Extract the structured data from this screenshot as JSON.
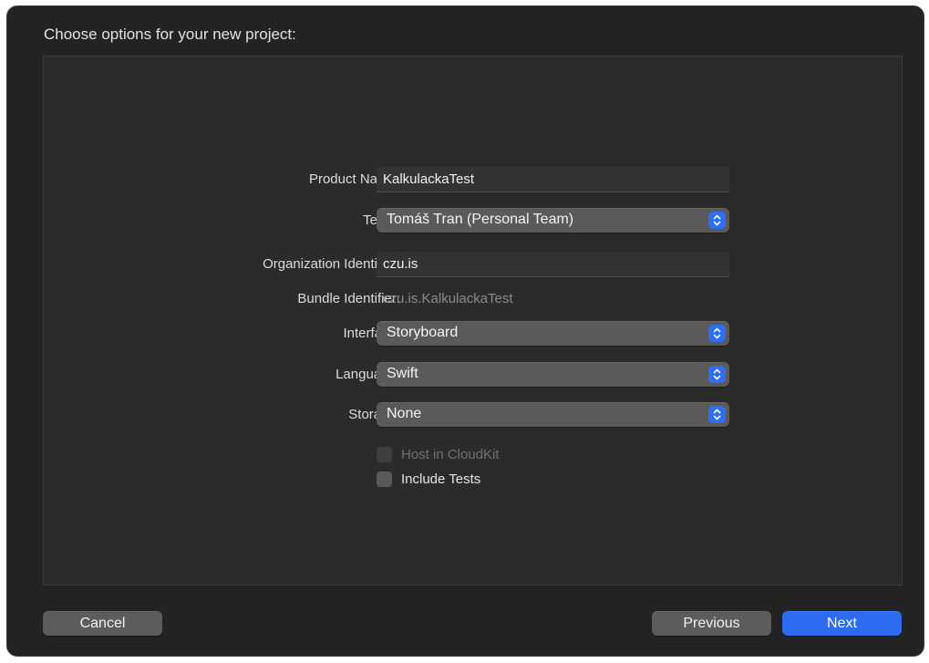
{
  "dialog": {
    "title": "Choose options for your new project:"
  },
  "form": {
    "product_name": {
      "label": "Product Name:",
      "value": "KalkulackaTest"
    },
    "team": {
      "label": "Team:",
      "value": "Tomáš Tran (Personal Team)"
    },
    "organization_identifier": {
      "label": "Organization Identifier:",
      "value": "czu.is"
    },
    "bundle_identifier": {
      "label": "Bundle Identifier:",
      "value": "czu.is.KalkulackaTest"
    },
    "interface": {
      "label": "Interface:",
      "value": "Storyboard"
    },
    "language": {
      "label": "Language:",
      "value": "Swift"
    },
    "storage": {
      "label": "Storage:",
      "value": "None"
    },
    "host_in_cloudkit": {
      "label": "Host in CloudKit",
      "checked": false,
      "enabled": false
    },
    "include_tests": {
      "label": "Include Tests",
      "checked": false,
      "enabled": true
    }
  },
  "buttons": {
    "cancel": "Cancel",
    "previous": "Previous",
    "next": "Next"
  },
  "colors": {
    "accent": "#2d6cf0",
    "sheet_background": "#232323",
    "panel_background": "#2b2b2b",
    "popup_background": "#5a5a5a"
  },
  "icons": {
    "popup_indicator": "chevron-up-down-icon"
  }
}
